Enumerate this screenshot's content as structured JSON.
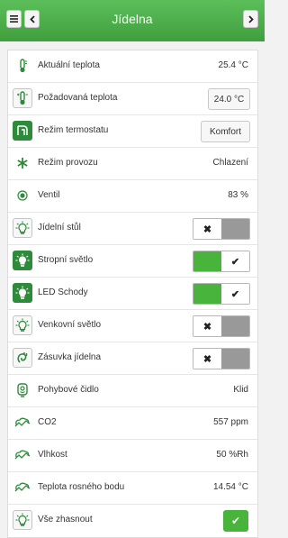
{
  "header": {
    "menu_icon": "menu-icon",
    "back_icon": "chevron-left-icon",
    "forward_icon": "chevron-right-icon",
    "title": "Jídelna"
  },
  "colors": {
    "header": "#4aae48",
    "toggle_on": "#48b43c",
    "toggle_off": "#999999",
    "icon_green": "#2e8b3a"
  },
  "rows": [
    {
      "label": "Aktuální teplota",
      "value": "25.4 °C",
      "icon": "thermometer-icon"
    },
    {
      "label": "Požadovaná teplota",
      "value": "24.0 °C",
      "icon": "thermometer-icon"
    },
    {
      "label": "Režim termostatu",
      "value": "Komfort",
      "icon": "thermostat-mode-icon"
    },
    {
      "label": "Režim provozu",
      "value": "Chlazení",
      "icon": "snowflake-icon"
    },
    {
      "label": "Ventil",
      "value": "83 %",
      "icon": "valve-icon"
    },
    {
      "label": "Jídelní stůl",
      "state": "off",
      "icon": "light-bulb-icon"
    },
    {
      "label": "Stropní světlo",
      "state": "on",
      "icon": "light-bulb-icon"
    },
    {
      "label": "LED Schody",
      "state": "on",
      "icon": "light-bulb-icon"
    },
    {
      "label": "Venkovní světlo",
      "state": "off",
      "icon": "light-bulb-icon"
    },
    {
      "label": "Zásuvka jídelna",
      "state": "off",
      "icon": "socket-icon"
    },
    {
      "label": "Pohybové čidlo",
      "value": "Klid",
      "icon": "motion-sensor-icon"
    },
    {
      "label": "CO2",
      "value": "557 ppm",
      "icon": "air-quality-icon"
    },
    {
      "label": "Vlhkost",
      "value": "50 %Rh",
      "icon": "air-quality-icon"
    },
    {
      "label": "Teplota rosného bodu",
      "value": "14.54 °C",
      "icon": "air-quality-icon"
    },
    {
      "label": "Vše zhasnout",
      "icon": "light-bulb-icon"
    }
  ],
  "toggle_glyphs": {
    "off": "✖",
    "on": "✔"
  }
}
